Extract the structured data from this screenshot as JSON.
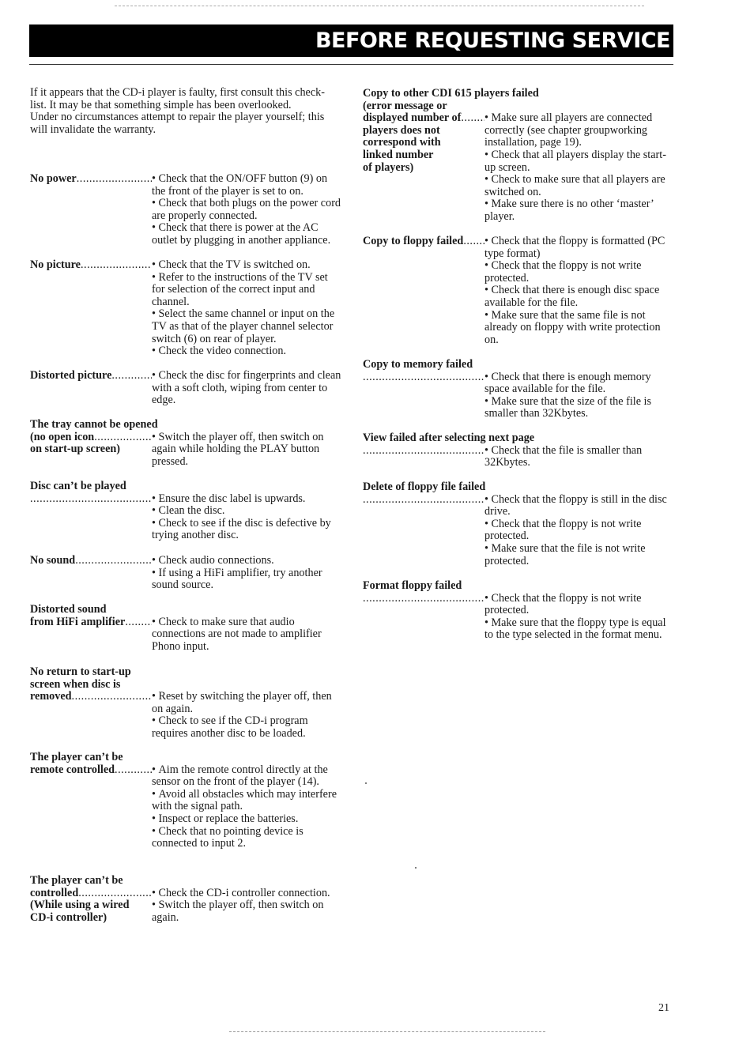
{
  "header": {
    "title": "BEFORE REQUESTING SERVICE"
  },
  "intro": [
    "If it appears that the CD-i player is faulty, first consult this check-list. It may be that something simple has been overlooked.",
    "Under no circumstances attempt to repair the player yourself; this will invalidate the warranty."
  ],
  "left_column": [
    {
      "problem": "No power",
      "label_lines": [
        "No power"
      ],
      "remedies": [
        "Check that the ON/OFF button (9) on the front of the player is set to on.",
        "Check that both plugs on the power cord are properly connected.",
        "Check that there is power at the AC outlet by plugging in another appliance."
      ]
    },
    {
      "problem": "No picture",
      "label_lines": [
        "No picture"
      ],
      "remedies": [
        "Check that the TV is switched on.",
        "Refer to the instructions of the TV set for selection of the correct input and channel.",
        "Select the same channel or input on the TV as that of the player channel selector switch (6) on rear of player.",
        "Check the video connection."
      ]
    },
    {
      "problem": "Distorted picture",
      "label_lines": [
        "Distorted picture"
      ],
      "remedies": [
        "Check the disc for fingerprints and clean with a soft cloth, wiping from center to edge."
      ]
    },
    {
      "problem": "The tray cannot be opened (no open icon on start-up screen)",
      "label_lines": [
        "The tray cannot be opened",
        "(no open icon",
        "on start-up screen)"
      ],
      "remedies": [
        "Switch the player off, then switch on again while holding the PLAY button pressed."
      ]
    },
    {
      "problem": "Disc can't be played",
      "label_lines": [
        "Disc can’t be played"
      ],
      "remedies": [
        "Ensure the disc label is upwards.",
        "Clean the disc.",
        "Check to see if the disc is defective by trying another disc."
      ]
    },
    {
      "problem": "No sound",
      "label_lines": [
        "No sound"
      ],
      "remedies": [
        "Check audio connections.",
        "If using a HiFi amplifier, try another sound source."
      ]
    },
    {
      "problem": "Distorted sound from HiFi amplifier",
      "label_lines": [
        "Distorted sound",
        "from HiFi amplifier"
      ],
      "remedies": [
        "Check to make sure that audio connections are not made to amplifier Phono input."
      ]
    },
    {
      "problem": "No return to start-up screen when disc is removed",
      "label_lines": [
        "No return to start-up",
        "screen when disc is",
        "removed"
      ],
      "remedies": [
        "Reset by switching the player off, then on again.",
        "Check to see if the CD-i program requires another disc to be loaded."
      ]
    },
    {
      "problem": "The player can't be remote controlled",
      "label_lines": [
        "The player can’t be",
        "remote controlled"
      ],
      "remedies": [
        "Aim the remote control directly at the sensor on the front of the player (14).",
        "Avoid all obstacles which may interfere with the signal path.",
        "Inspect or replace the batteries.",
        "Check that no pointing device is connected to input 2."
      ]
    },
    {
      "problem": "The player can't be controlled (While using a wired CD-i controller)",
      "label_lines": [
        "The player can’t be",
        "controlled",
        "(While using a wired",
        "CD-i controller)"
      ],
      "remedies": [
        "Check the CD-i controller connection.",
        "Switch the player off, then switch on again."
      ]
    }
  ],
  "right_column": [
    {
      "problem": "Copy to other CDI 615 players failed (error message or displayed number of players does not correspond with linked number of players)",
      "label_lines": [
        "Copy to other CDI 615 players  failed",
        "(error message or",
        "displayed number of",
        "players does not",
        "correspond with",
        "linked number",
        "of players)"
      ],
      "remedies": [
        "Make sure all players are connected correctly (see chapter groupworking installation, page 19).",
        "Check that all players display the start-up screen.",
        "Check to make sure that all players are switched on.",
        "Make sure there is no other ‘master’ player."
      ]
    },
    {
      "problem": "Copy to floppy failed",
      "label_lines": [
        "Copy to floppy failed"
      ],
      "remedies": [
        "Check that the floppy is formatted (PC type format)",
        "Check that the floppy is not write protected.",
        "Check that there is enough disc space available for the file.",
        "Make sure that the same file is not already on floppy with write protection on."
      ]
    },
    {
      "problem": "Copy to memory failed",
      "label_lines": [
        "Copy to memory failed"
      ],
      "remedies": [
        "Check that there is enough memory space available for the file.",
        "Make sure that the size of the file is smaller than 32Kbytes."
      ]
    },
    {
      "problem": "View failed after selecting next page",
      "label_lines": [
        "View failed after selecting next page"
      ],
      "remedies": [
        "Check that the file is smaller than 32Kbytes."
      ]
    },
    {
      "problem": "Delete of floppy file failed",
      "label_lines": [
        "Delete of floppy file failed"
      ],
      "remedies": [
        "Check that the floppy is still in the disc drive.",
        "Check that the floppy  is not write protected.",
        "Make sure that the file is not write protected."
      ]
    },
    {
      "problem": "Format floppy failed",
      "label_lines": [
        "Format floppy failed"
      ],
      "remedies": [
        "Check that the floppy is not write protected.",
        "Make sure that the floppy type is equal to the type selected in the format menu."
      ]
    }
  ],
  "footer": {
    "page_number": "21"
  }
}
